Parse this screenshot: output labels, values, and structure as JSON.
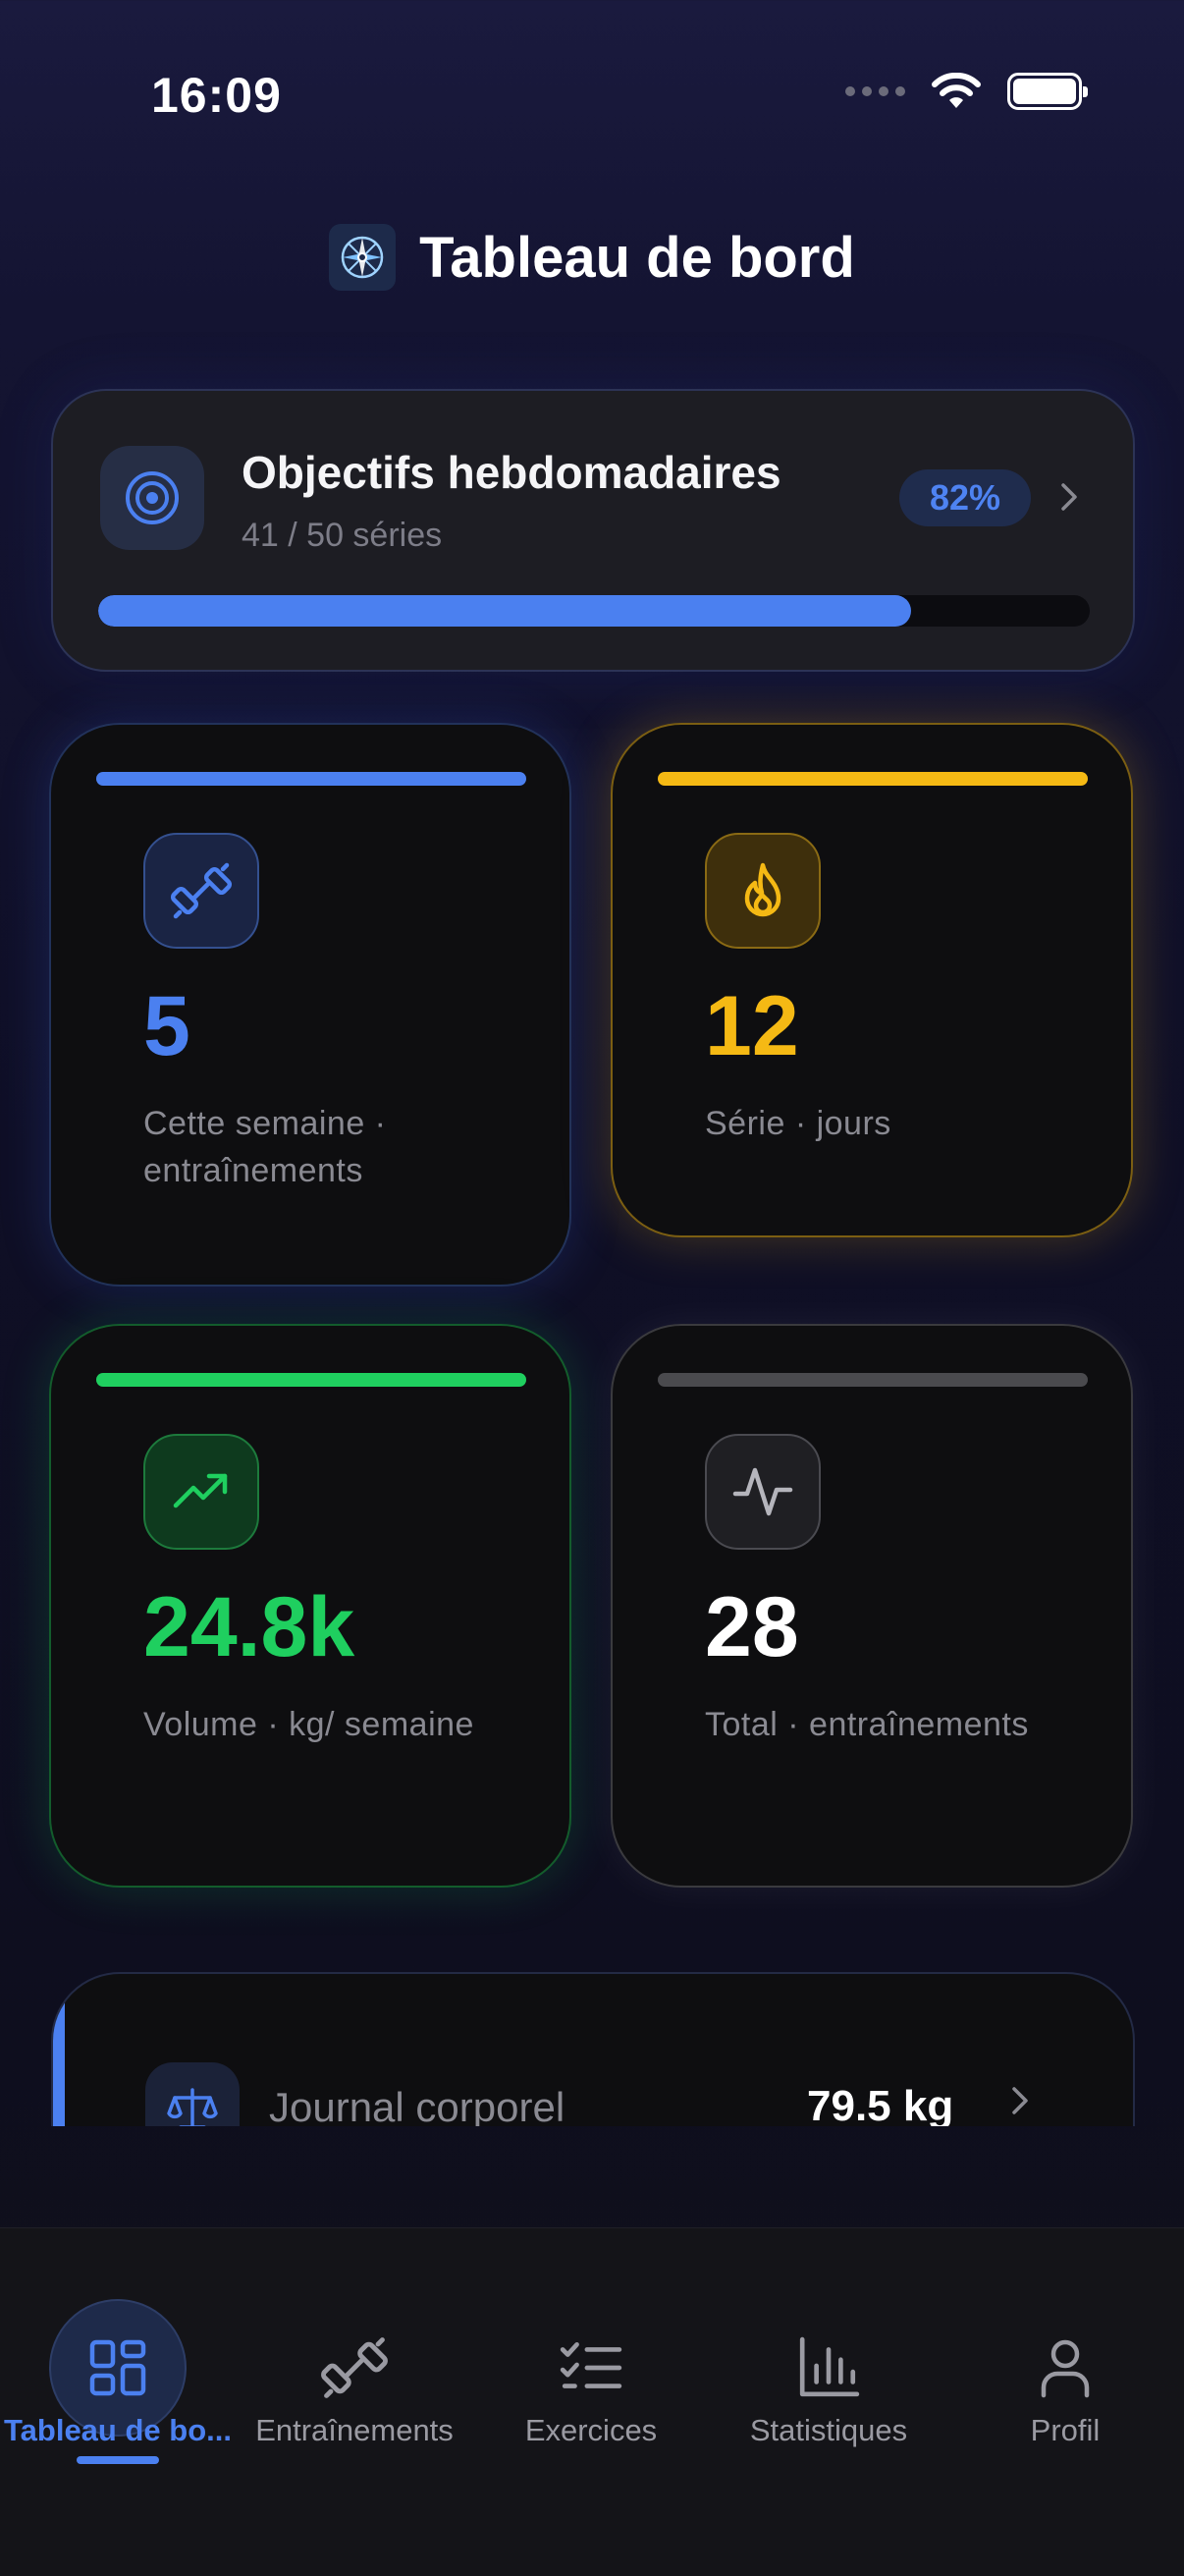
{
  "status_bar": {
    "time": "16:09"
  },
  "header": {
    "title": "Tableau de bord",
    "logo_icon": "compass-icon"
  },
  "goals": {
    "title": "Objectifs hebdomadaires",
    "subtitle": "41 / 50 séries",
    "percent_label": "82%",
    "progress": 0.82,
    "icon": "target-icon"
  },
  "stats": [
    {
      "value": "5",
      "label": "Cette semaine · entraînements",
      "icon": "dumbbell-icon",
      "color": "#4b80f0"
    },
    {
      "value": "12",
      "label": "Série · jours",
      "icon": "flame-icon",
      "color": "#f5b914"
    },
    {
      "value": "24.8k",
      "label": "Volume · kg/ semaine",
      "icon": "trending-up-icon",
      "color": "#1fcf5f"
    },
    {
      "value": "28",
      "label": "Total · entraînements",
      "icon": "activity-icon",
      "color": "#ffffff"
    }
  ],
  "journal": {
    "label": "Journal corporel",
    "value": "79.5 kg",
    "icon": "scale-icon"
  },
  "tabs": [
    {
      "label": "Tableau de bo...",
      "icon": "dashboard-icon",
      "active": true
    },
    {
      "label": "Entraînements",
      "icon": "dumbbell-icon",
      "active": false
    },
    {
      "label": "Exercices",
      "icon": "checklist-icon",
      "active": false
    },
    {
      "label": "Statistiques",
      "icon": "bar-chart-icon",
      "active": false
    },
    {
      "label": "Profil",
      "icon": "user-icon",
      "active": false
    }
  ],
  "colors": {
    "accent": "#4b80f0",
    "streak": "#f5b914",
    "volume": "#1fcf5f"
  }
}
